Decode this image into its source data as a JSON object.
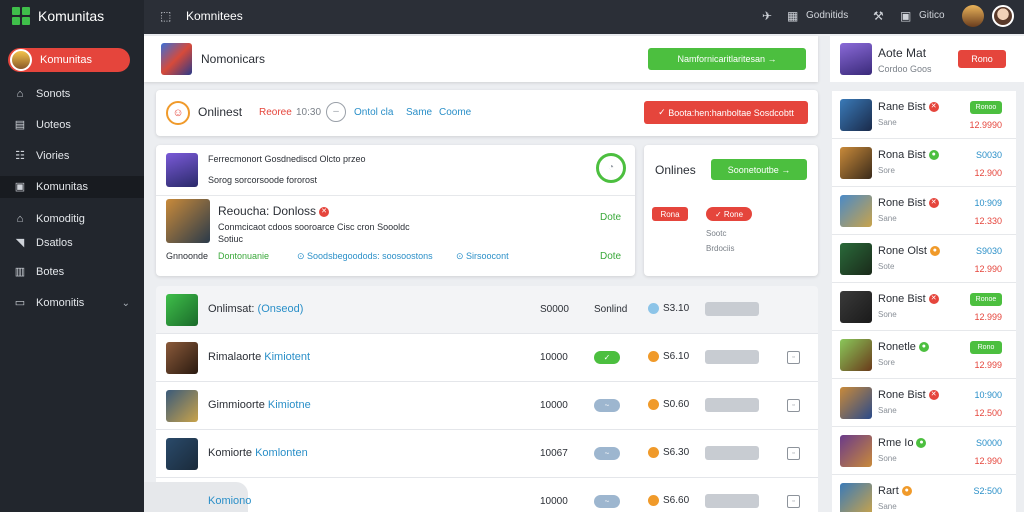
{
  "app": {
    "brand": "Komunitas"
  },
  "sidebar": {
    "profile_label": "Komunitas",
    "items": [
      {
        "label": "Sonots",
        "icon": "home-icon"
      },
      {
        "label": "Uoteos",
        "icon": "chart-icon"
      },
      {
        "label": "Viories",
        "icon": "list-icon"
      },
      {
        "label": "Komunitas",
        "icon": "people-icon",
        "active": true
      },
      {
        "label": "Komoditig",
        "icon": "home-icon"
      },
      {
        "label": "Dsatlos",
        "icon": "tag-icon"
      },
      {
        "label": "Botes",
        "icon": "book-icon"
      },
      {
        "label": "Komonitis",
        "icon": "chat-icon",
        "has_chevron": true
      }
    ]
  },
  "topbar": {
    "title": "Komnitees",
    "label_a": "Godnitids",
    "label_b": "Gitico"
  },
  "header_card": {
    "title": "Nomonicars",
    "button": "Namfornicaritlaritesan"
  },
  "status_card": {
    "label": "Onlinest",
    "red_text": "Reoree",
    "time": "10:30",
    "link_a": "Ontol cla",
    "link_b": "Same",
    "link_c": "Coome",
    "button": "Boota:hen:hanboltae Sosdcobtt"
  },
  "feature_card": {
    "top_text": "Ferrecmonort Gosdnediscd Olcto przeo",
    "top_sub": "Sorog sorcorsoode fororost",
    "title": "Reoucha: Donloss",
    "desc": "Conmcicaot cdoos sooroarce Cisc cron Soooldc",
    "desc2": "Sotiuc",
    "right_a": "Dote",
    "right_b": "Dote",
    "footer_a": "Gnnoonde",
    "footer_b": "Dontonuanie",
    "footer_c": "Soodsbegoodods: soosoostons",
    "footer_d": "Sirsoocont"
  },
  "online_card": {
    "label": "Onlines",
    "button": "Soonetoutbe",
    "red_a": "Rona",
    "red_b": "Rone",
    "sub_a": "Sootc",
    "sub_b": "Brdociis"
  },
  "table": {
    "header": {
      "name": "Onlimsat:",
      "tag": "(Onseod)",
      "num": "S0000",
      "status": "Sonlind",
      "coin": "S3.10"
    },
    "rows": [
      {
        "name_a": "Rimalaorte",
        "name_b": "Kimiotent",
        "num": "10000",
        "coin": "S6.10",
        "pill": "green"
      },
      {
        "name_a": "Gimmioorte",
        "name_b": "Kimiotne",
        "num": "10000",
        "coin": "S0.60",
        "pill": "blue"
      },
      {
        "name_a": "Komiorte",
        "name_b": "Komlonten",
        "num": "10067",
        "coin": "S6.30",
        "pill": "blue"
      },
      {
        "name_a": "",
        "name_b": "Komiono",
        "num": "10000",
        "coin": "S6.60",
        "pill": "blue"
      }
    ]
  },
  "right_panel": {
    "header": {
      "title": "Aote Mat",
      "sub": "Cordoo Goos",
      "button": "Rono"
    },
    "items": [
      {
        "name": "Rane Bist",
        "sub": "Sane",
        "pill": "Ronoo",
        "pillcolor": "green",
        "v2": "12.9990",
        "dot": "red"
      },
      {
        "name": "Rona Bist",
        "sub": "Sore",
        "v1": "S0030",
        "v2": "12.900",
        "dot": "green"
      },
      {
        "name": "Rone Bist",
        "sub": "Sane",
        "v1": "10:909",
        "v2": "12.330",
        "dot": "red"
      },
      {
        "name": "Rone Olst",
        "sub": "Sote",
        "v1": "S9030",
        "v2": "12.990",
        "dot": "orange"
      },
      {
        "name": "Rone Bist",
        "sub": "Sone",
        "pill": "Ronoe",
        "pillcolor": "green",
        "v2": "12.999",
        "dot": "red"
      },
      {
        "name": "Ronetle",
        "sub": "Sore",
        "pill": "Rono",
        "pillcolor": "green",
        "v2": "12.999",
        "dot": "green"
      },
      {
        "name": "Rone Bist",
        "sub": "Sane",
        "v1": "10:900",
        "v2": "12.500",
        "dot": "red"
      },
      {
        "name": "Rme Io",
        "sub": "Sone",
        "v1": "S0000",
        "v2": "12.990",
        "dot": "green"
      },
      {
        "name": "Rart",
        "sub": "Sane",
        "v1": "S2:500",
        "v2": "",
        "dot": "orange"
      }
    ]
  },
  "colors": {
    "accent": "#e5453c",
    "success": "#4cbf3f",
    "sidebar": "#22262d",
    "topbar": "#2b2f37",
    "link": "#2a8fc8"
  }
}
